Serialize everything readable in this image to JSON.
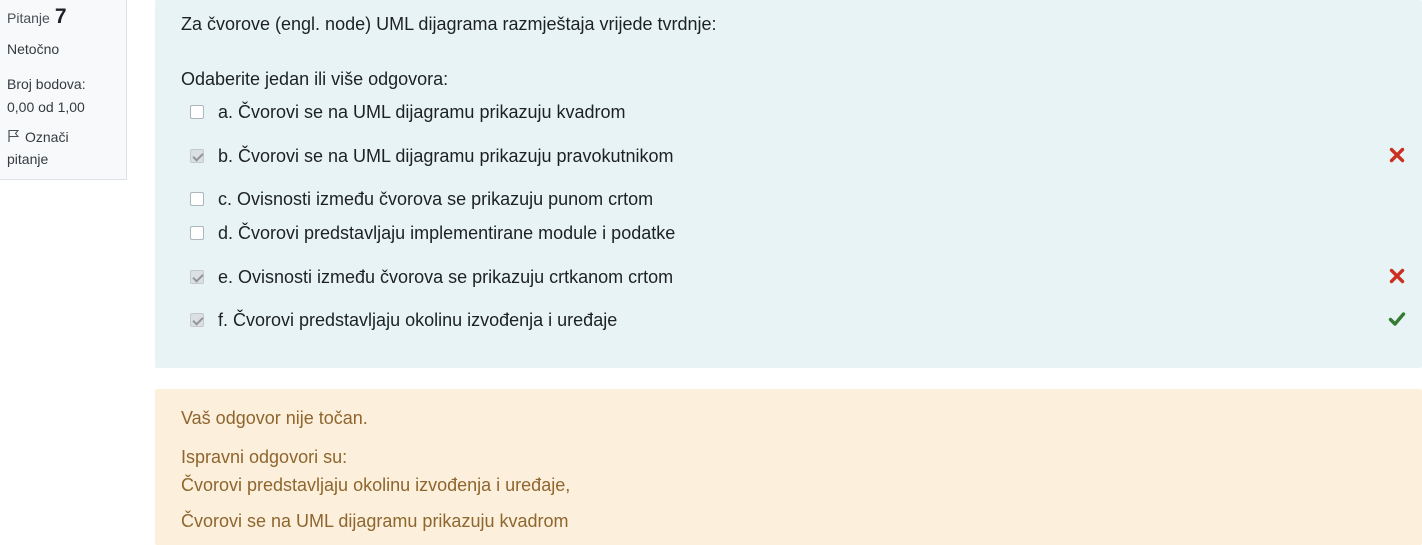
{
  "info": {
    "question_label": "Pitanje",
    "question_number": "7",
    "state": "Netočno",
    "grade_label": "Broj bodova:",
    "grade_value": "0,00 od 1,00",
    "flag_label_line1": "Označi",
    "flag_label_line2": "pitanje"
  },
  "question": {
    "text": "Za čvorove (engl. node) UML dijagrama razmještaja vrijede tvrdnje:",
    "prompt": "Odaberite jedan ili više odgovora:",
    "answers": [
      {
        "label": "a. Čvorovi se na UML dijagramu prikazuju kvadrom",
        "checked": false,
        "mark": "none"
      },
      {
        "label": "b. Čvorovi se na UML dijagramu prikazuju pravokutnikom",
        "checked": true,
        "mark": "incorrect"
      },
      {
        "label": "c. Ovisnosti između čvorova se prikazuju punom crtom",
        "checked": false,
        "mark": "none"
      },
      {
        "label": "d. Čvorovi predstavljaju implementirane module i podatke",
        "checked": false,
        "mark": "none"
      },
      {
        "label": "e. Ovisnosti između čvorova se prikazuju crtkanom crtom",
        "checked": true,
        "mark": "incorrect"
      },
      {
        "label": "f. Čvorovi predstavljaju okolinu izvođenja i uređaje",
        "checked": true,
        "mark": "correct"
      }
    ]
  },
  "feedback": {
    "status": "Vaš odgovor nije točan.",
    "correct_heading": "Ispravni odgovori su:",
    "correct_answer_1": "Čvorovi predstavljaju okolinu izvođenja i uređaje,",
    "correct_answer_2": "Čvorovi se na UML dijagramu prikazuju kvadrom"
  },
  "colors": {
    "formulation_bg": "#e7f3f5",
    "feedback_bg": "#fcefdc",
    "feedback_text": "#8e662e",
    "incorrect_mark": "#ca3120",
    "correct_mark": "#357a32"
  }
}
